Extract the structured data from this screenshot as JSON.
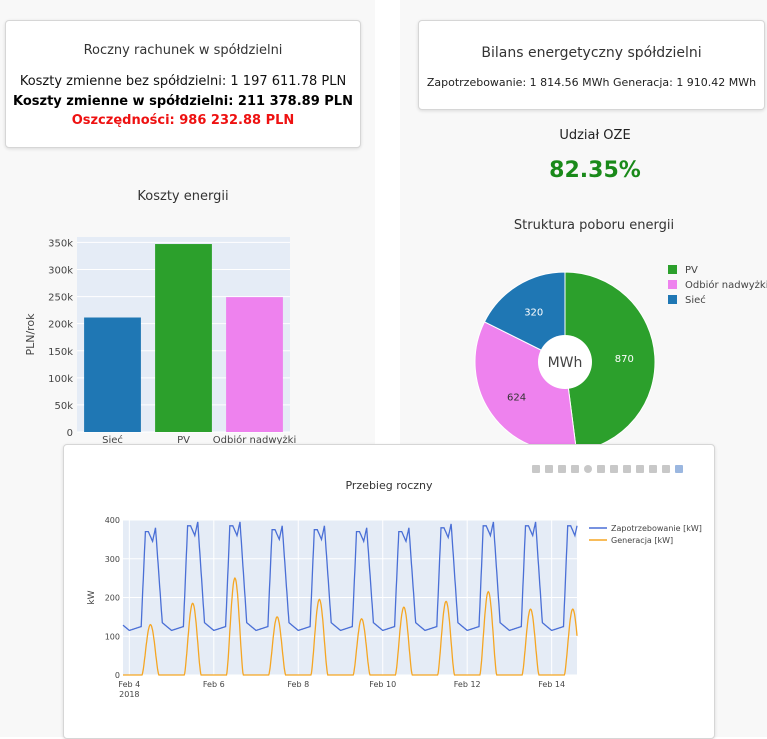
{
  "bill": {
    "title": "Roczny rachunek w spółdzielni",
    "line1": "Koszty zmienne bez spółdzielni: 1 197 611.78 PLN",
    "line2": "Koszty zmienne w spółdzielni: 211 378.89 PLN",
    "line3": "Oszczędności: 986 232.88 PLN"
  },
  "balance": {
    "title": "Bilans energetyczny spółdzielni",
    "line1": "Zapotrzebowanie: 1 814.56 MWh Generacja: 1 910.42 MWh"
  },
  "oze": {
    "label": "Udział OZE",
    "value": "82.35%"
  },
  "chart_data": [
    {
      "type": "bar",
      "title": "Koszty energii",
      "ylabel": "PLN/rok",
      "xlabel": "",
      "categories": [
        "Sieć",
        "PV",
        "Odbiór nadwyżki"
      ],
      "values": [
        211379,
        347000,
        249000
      ],
      "colors": [
        "#1f77b4",
        "#2ca02c",
        "#ee82ee"
      ],
      "ylim": [
        0,
        360000
      ],
      "yticks": [
        0,
        50000,
        100000,
        150000,
        200000,
        250000,
        300000,
        350000
      ],
      "ytick_labels": [
        "0",
        "50k",
        "100k",
        "150k",
        "200k",
        "250k",
        "300k",
        "350k"
      ],
      "grid": true
    },
    {
      "type": "pie",
      "title": "Struktura poboru energii",
      "center_label": "MWh",
      "labels": [
        "PV",
        "Odbiór nadwyżki",
        "Sieć"
      ],
      "values": [
        870,
        624,
        320
      ],
      "colors": [
        "#2ca02c",
        "#ee82ee",
        "#1f77b4"
      ],
      "legend": "right"
    },
    {
      "type": "line",
      "title": "Przebieg roczny",
      "ylabel": "kW",
      "xlabel": "",
      "x_start": "2018-02-03",
      "x_end": "2018-02-15",
      "xlim_days": [
        0.85,
        11.6
      ],
      "ylim": [
        0,
        400
      ],
      "yticks": [
        0,
        100,
        200,
        300,
        400
      ],
      "xtick_days": [
        1,
        3,
        5,
        7,
        9,
        11
      ],
      "xtick_labels": [
        "Feb 4",
        "Feb 6",
        "Feb 8",
        "Feb 10",
        "Feb 12",
        "Feb 14"
      ],
      "year_label": "2018",
      "legend": "top-right",
      "series": [
        {
          "name": "Zapotrzebowanie [kW]",
          "color": "#4a6fd6",
          "night_kw": 115,
          "daily_peaks_kw": [
            350,
            370,
            385,
            385,
            375,
            375,
            370,
            370,
            380,
            385,
            385
          ]
        },
        {
          "name": "Generacja [kW]",
          "color": "#f5a623",
          "night_kw": 0,
          "daily_peaks_kw": [
            185,
            130,
            185,
            250,
            150,
            195,
            145,
            175,
            190,
            215,
            170
          ]
        }
      ]
    }
  ]
}
